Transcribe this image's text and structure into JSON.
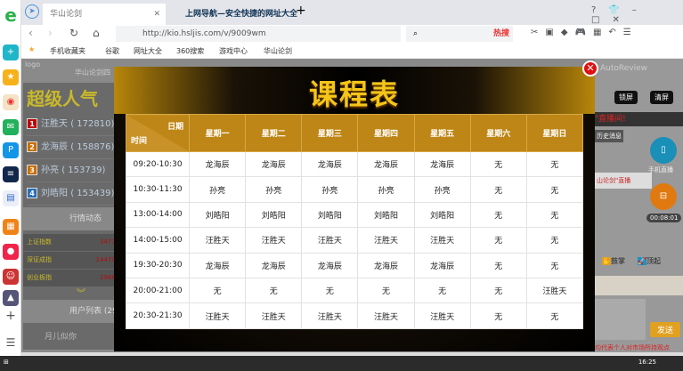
{
  "browser": {
    "tabs": [
      "华山论剑",
      "上网导航—安全快捷的网址大全"
    ],
    "url": "http://kio.hsljis.com/v/9009wm",
    "search_hot": "热搜",
    "bookmarks": [
      "手机收藏夹",
      "谷歌",
      "网址大全",
      "360搜索",
      "游戏中心",
      "华山论剑"
    ]
  },
  "left_panel": {
    "logo": "logo",
    "room": "华山论剑四",
    "banner": "超级人气",
    "ranks": [
      {
        "n": "1",
        "name": "汪胜天",
        "score": "( 172810)",
        "color": "#c00000"
      },
      {
        "n": "2",
        "name": "龙海辰",
        "score": "( 158876)",
        "color": "#c87000"
      },
      {
        "n": "3",
        "name": "孙亮",
        "score": "( 153739)",
        "color": "#c87000"
      },
      {
        "n": "4",
        "name": "刘皓阳",
        "score": "( 153439)",
        "color": "#2a6ebb"
      }
    ],
    "market_title": "行情动态",
    "market": [
      {
        "name": "上证指数",
        "value": "3473."
      },
      {
        "name": "深证成指",
        "value": "14470."
      },
      {
        "name": "创业板指",
        "value": "2966."
      }
    ],
    "users_title": "用户列表 (29",
    "user": "月儿似你"
  },
  "modal": {
    "title": "课程表",
    "corner_date": "日期",
    "corner_time": "时间",
    "days": [
      "星期一",
      "星期二",
      "星期三",
      "星期四",
      "星期五",
      "星期六",
      "星期日"
    ],
    "rows": [
      {
        "time": "09:20-10:30",
        "cells": [
          "龙海辰",
          "龙海辰",
          "龙海辰",
          "龙海辰",
          "龙海辰",
          "无",
          "无"
        ]
      },
      {
        "time": "10:30-11:30",
        "cells": [
          "孙亮",
          "孙亮",
          "孙亮",
          "孙亮",
          "孙亮",
          "无",
          "无"
        ]
      },
      {
        "time": "13:00-14:00",
        "cells": [
          "刘皓阳",
          "刘皓阳",
          "刘皓阳",
          "刘皓阳",
          "刘皓阳",
          "无",
          "无"
        ]
      },
      {
        "time": "14:00-15:00",
        "cells": [
          "汪胜天",
          "汪胜天",
          "汪胜天",
          "汪胜天",
          "汪胜天",
          "无",
          "无"
        ]
      },
      {
        "time": "19:30-20:30",
        "cells": [
          "龙海辰",
          "龙海辰",
          "龙海辰",
          "龙海辰",
          "龙海辰",
          "无",
          "无"
        ]
      },
      {
        "time": "20:00-21:00",
        "cells": [
          "无",
          "无",
          "无",
          "无",
          "无",
          "无",
          "汪胜天"
        ]
      },
      {
        "time": "20:30-21:30",
        "cells": [
          "汪胜天",
          "汪胜天",
          "汪胜天",
          "汪胜天",
          "汪胜天",
          "无",
          "无"
        ]
      }
    ]
  },
  "right_panel": {
    "user": "AutoReview",
    "lock": "锁屏",
    "clear": "清屏",
    "live": "\"直播间!",
    "history": "历史消息",
    "live_note": "山论剑\"直播",
    "mobile": "手机直播",
    "timer": "00:08:01",
    "clap": "鼓掌",
    "top": "顶起",
    "send": "发送",
    "disclaimer": "均代表个人对市场所持观点"
  },
  "taskbar": {
    "time": "16:25"
  }
}
